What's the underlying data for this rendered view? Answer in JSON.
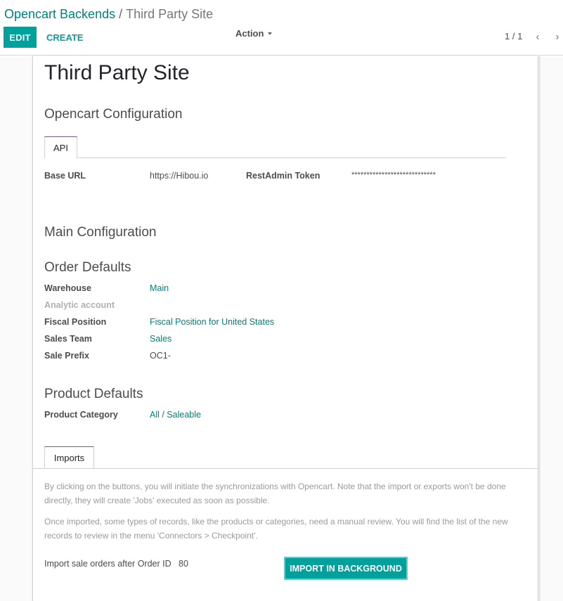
{
  "breadcrumb": {
    "parent": "Opencart Backends",
    "separator": "/",
    "current": "Third Party Site"
  },
  "toolbar": {
    "edit_label": "EDIT",
    "create_label": "CREATE",
    "action_label": "Action"
  },
  "pager": {
    "value": "1 / 1",
    "prev_icon": "‹",
    "next_icon": "›"
  },
  "form": {
    "title": "Third Party Site",
    "opencart_config": {
      "heading": "Opencart Configuration",
      "tabs": [
        {
          "label": "API",
          "active": true
        }
      ],
      "fields": {
        "base_url_label": "Base URL",
        "base_url_value": "https://Hibou.io",
        "token_label": "RestAdmin Token",
        "token_value": "****************************"
      }
    },
    "main_config": {
      "heading": "Main Configuration"
    },
    "order_defaults": {
      "heading": "Order Defaults",
      "fields": [
        {
          "label": "Warehouse",
          "value": "Main",
          "link": true
        },
        {
          "label": "Analytic account",
          "value": "",
          "muted": true
        },
        {
          "label": "Fiscal Position",
          "value": "Fiscal Position for United States",
          "link": true
        },
        {
          "label": "Sales Team",
          "value": "Sales",
          "link": true
        },
        {
          "label": "Sale Prefix",
          "value": "OC1-",
          "link": false
        }
      ]
    },
    "product_defaults": {
      "heading": "Product Defaults",
      "fields": [
        {
          "label": "Product Category",
          "value": "All / Saleable",
          "link": true
        }
      ]
    },
    "imports": {
      "tabs": [
        {
          "label": "Imports",
          "active": true
        }
      ],
      "help_1": "By clicking on the buttons, you will initiate the synchronizations with Opencart. Note that the import or exports won't be done directly, they will create 'Jobs' executed as soon as possible.",
      "help_2": "Once imported, some types of records, like the products or categories, need a manual review. You will find the list of the new records to review in the menu 'Connectors > Checkpoint'.",
      "import_after_label": "Import sale orders after Order ID",
      "import_after_value": "80",
      "import_button_label": "IMPORT IN BACKGROUND"
    }
  },
  "colors": {
    "primary": "#00a09d",
    "link": "#00827c",
    "tab_accent": "#7c5a7e"
  }
}
